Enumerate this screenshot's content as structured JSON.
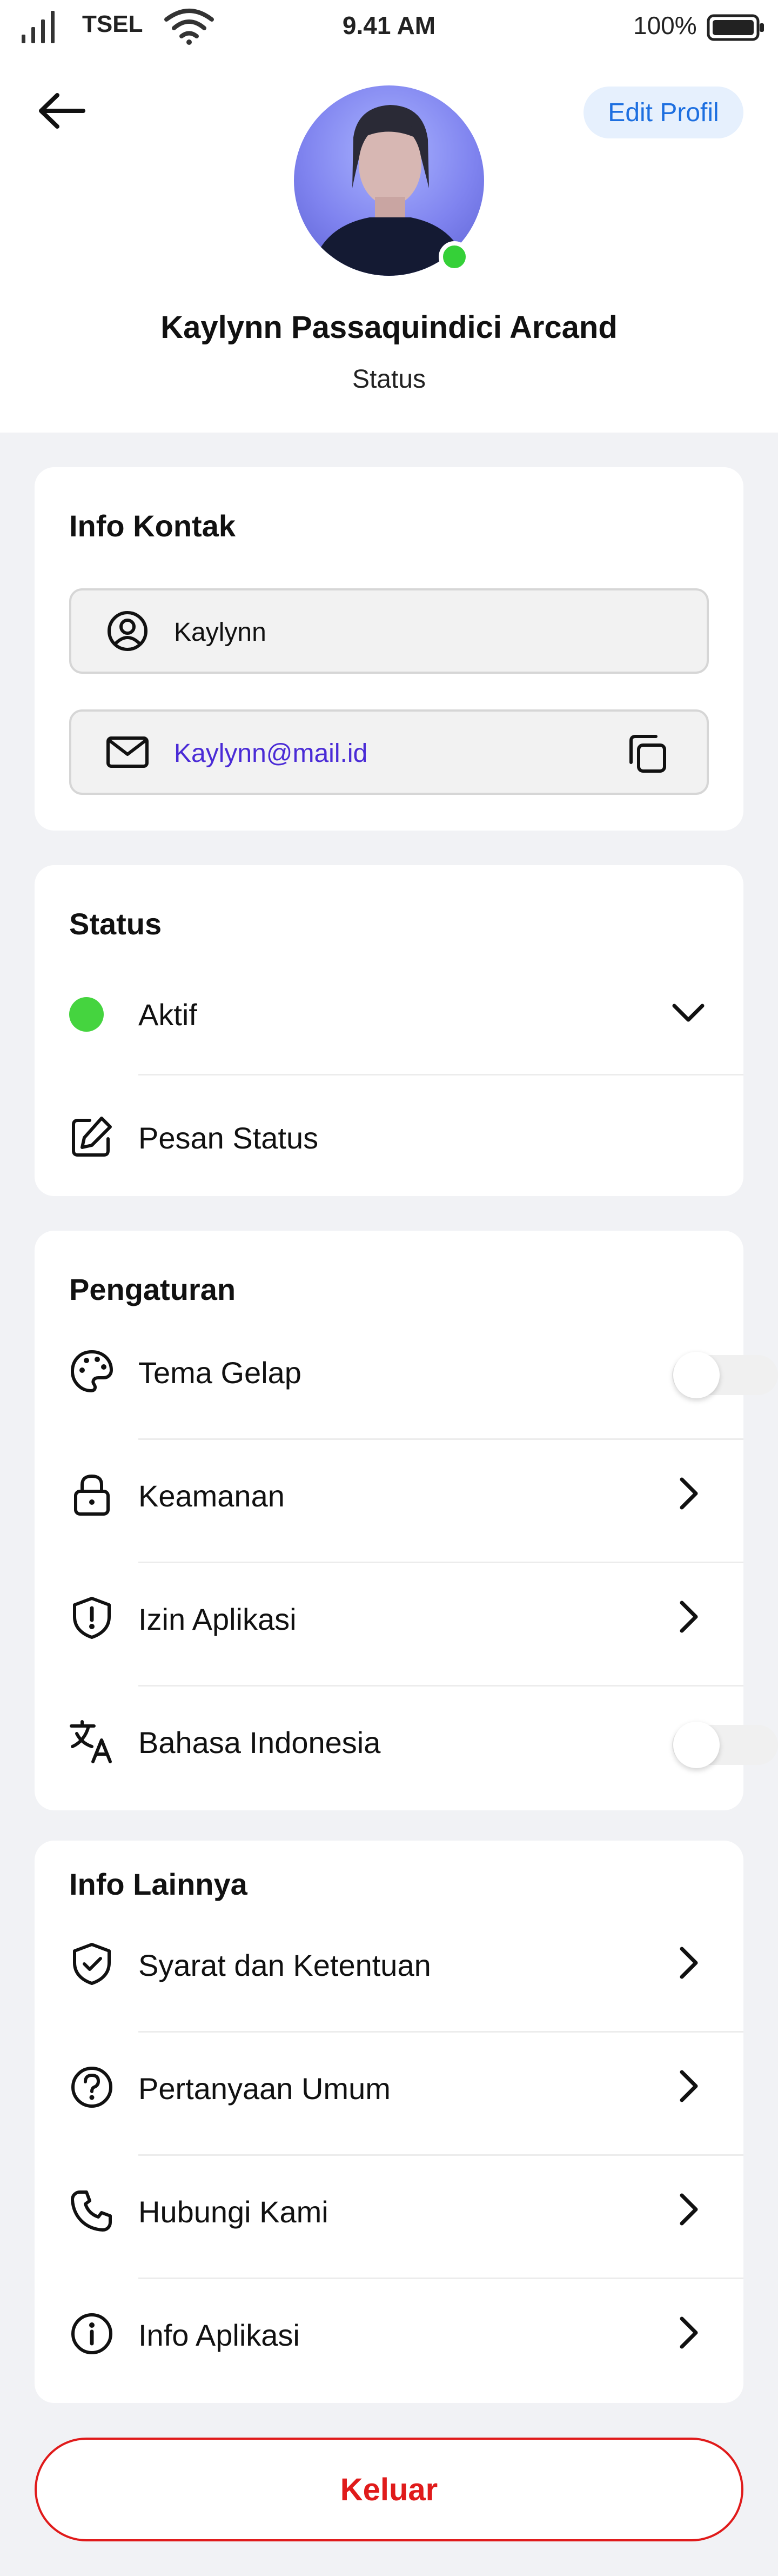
{
  "status_bar": {
    "carrier": "TSEL",
    "time": "9.41 AM",
    "battery": "100%"
  },
  "header": {
    "edit_label": "Edit Profil",
    "name": "Kaylynn Passaquindici Arcand",
    "status": "Status"
  },
  "contact": {
    "title": "Info Kontak",
    "username": "Kaylynn",
    "email": "Kaylynn@mail.id"
  },
  "status_card": {
    "title": "Status",
    "current": "Aktif",
    "message_label": "Pesan Status"
  },
  "settings": {
    "title": "Pengaturan",
    "items": [
      {
        "label": "Tema Gelap",
        "icon": "palette-icon",
        "control": "toggle",
        "on": false
      },
      {
        "label": "Keamanan",
        "icon": "lock-icon",
        "control": "chevron"
      },
      {
        "label": "Izin Aplikasi",
        "icon": "shield-alert-icon",
        "control": "chevron"
      },
      {
        "label": "Bahasa Indonesia",
        "icon": "translate-icon",
        "control": "toggle",
        "on": false
      }
    ]
  },
  "other": {
    "title": "Info Lainnya",
    "items": [
      {
        "label": "Syarat dan Ketentuan",
        "icon": "shield-check-icon"
      },
      {
        "label": "Pertanyaan Umum",
        "icon": "help-circle-icon"
      },
      {
        "label": "Hubungi Kami",
        "icon": "phone-icon"
      },
      {
        "label": "Info Aplikasi",
        "icon": "info-icon"
      }
    ]
  },
  "logout_label": "Keluar",
  "colors": {
    "accent_blue": "#1d6fe0",
    "online_green": "#35d038",
    "danger_red": "#e01b1b",
    "email_link": "#4a2bd6"
  }
}
